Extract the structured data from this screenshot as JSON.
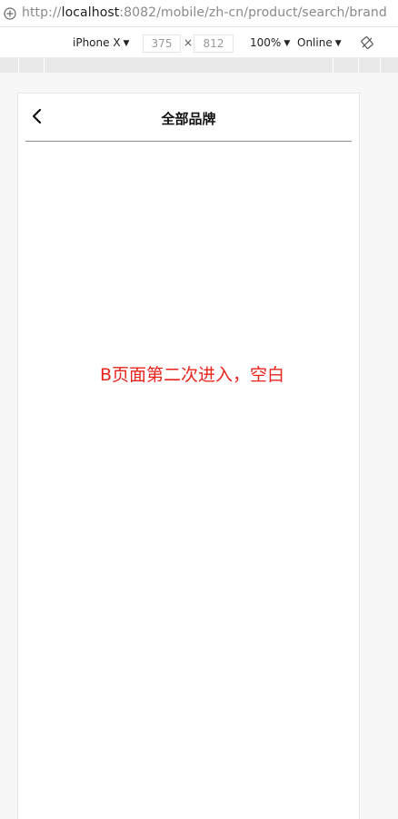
{
  "browser": {
    "url_prefix": "http://",
    "url_host": "localhost",
    "url_rest": ":8082/mobile/zh-cn/product/search/brand"
  },
  "device_toolbar": {
    "device": "iPhone X",
    "width": "375",
    "times": "×",
    "height": "812",
    "zoom": "100%",
    "network": "Online",
    "caret": "▼"
  },
  "page": {
    "title": "全部品牌",
    "annotation": "B页面第二次进入，空白"
  },
  "colors": {
    "annotation": "#e8241c",
    "divider": "#8c8c8c"
  },
  "icons": {
    "site": "info-circle-icon",
    "rotate": "rotate-icon",
    "back": "chevron-left-icon"
  }
}
